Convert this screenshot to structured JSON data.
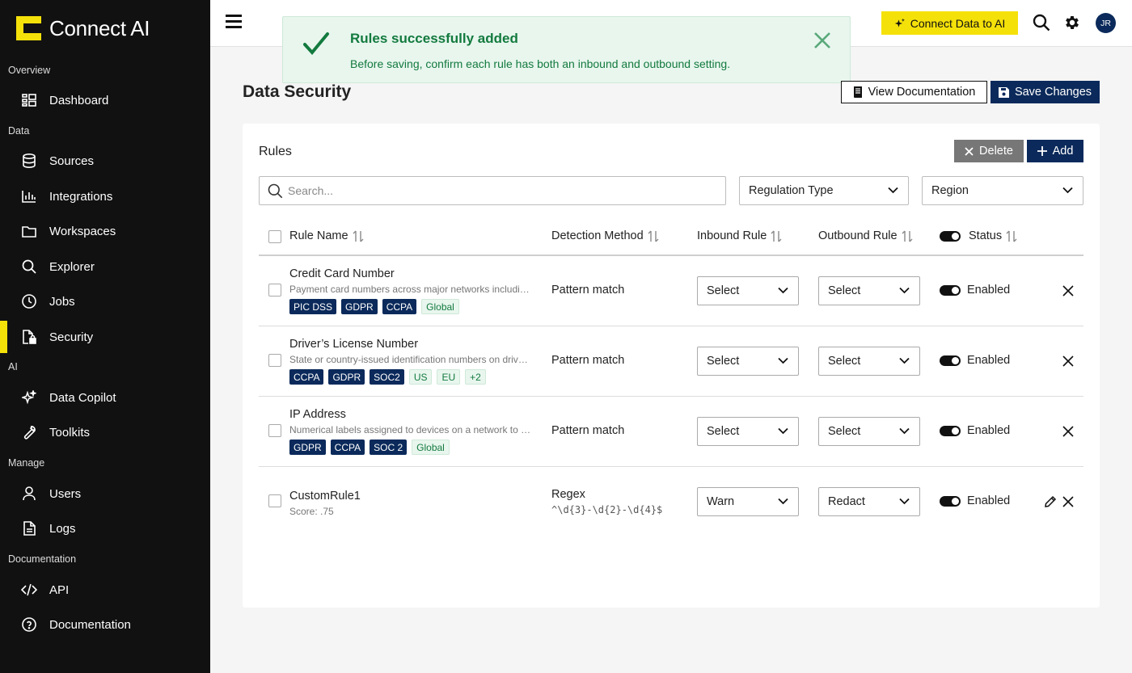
{
  "brand": {
    "name": "Connect AI",
    "accent": "#f5e10a"
  },
  "sidebar": {
    "sections": [
      {
        "label": "Overview"
      },
      {
        "label": "Data"
      },
      {
        "label": "AI"
      },
      {
        "label": "Manage"
      },
      {
        "label": "Documentation"
      }
    ],
    "items": [
      {
        "label": "Dashboard",
        "icon": "dashboard-icon"
      },
      {
        "label": "Sources",
        "icon": "database-icon"
      },
      {
        "label": "Integrations",
        "icon": "bar-chart-icon"
      },
      {
        "label": "Workspaces",
        "icon": "folder-icon"
      },
      {
        "label": "Explorer",
        "icon": "search-icon"
      },
      {
        "label": "Jobs",
        "icon": "clock-icon"
      },
      {
        "label": "Security",
        "icon": "document-lock-icon",
        "active": true
      },
      {
        "label": "Data Copilot",
        "icon": "sparkle-icon"
      },
      {
        "label": "Toolkits",
        "icon": "wrench-icon"
      },
      {
        "label": "Users",
        "icon": "user-icon"
      },
      {
        "label": "Logs",
        "icon": "file-text-icon"
      },
      {
        "label": "API",
        "icon": "code-icon"
      },
      {
        "label": "Documentation",
        "icon": "help-circle-icon"
      }
    ]
  },
  "topbar": {
    "connect_label": "Connect Data to AI",
    "avatar_initials": "JR"
  },
  "toast": {
    "title": "Rules successfully added",
    "message": "Before saving, confirm each rule has both an inbound and outbound setting.",
    "color": "#137a3e"
  },
  "page": {
    "title": "Data Security",
    "view_docs_label": "View Documentation",
    "save_label": "Save Changes"
  },
  "rules": {
    "title": "Rules",
    "delete_label": "Delete",
    "add_label": "Add",
    "search_placeholder": "Search...",
    "filters": {
      "regulation": "Regulation Type",
      "region": "Region"
    },
    "columns": {
      "name": "Rule Name",
      "method": "Detection Method",
      "inbound": "Inbound Rule",
      "outbound": "Outbound Rule",
      "status": "Status"
    },
    "rows": [
      {
        "name": "Credit Card Number",
        "description": "Payment card numbers across major networks including Visa, Mastercard and Amex",
        "tags": [
          {
            "text": "PIC DSS",
            "style": "dark"
          },
          {
            "text": "GDPR",
            "style": "dark"
          },
          {
            "text": "CCPA",
            "style": "dark"
          },
          {
            "text": "Global",
            "style": "light"
          }
        ],
        "method": "Pattern match",
        "inbound": "Select",
        "outbound": "Select",
        "status": "Enabled"
      },
      {
        "name": "Driver’s License Number",
        "description": "State or country-issued identification numbers on driver licenses",
        "tags": [
          {
            "text": "CCPA",
            "style": "dark"
          },
          {
            "text": "GDPR",
            "style": "dark"
          },
          {
            "text": "SOC2",
            "style": "dark"
          },
          {
            "text": "US",
            "style": "light"
          },
          {
            "text": "EU",
            "style": "light"
          },
          {
            "text": "+2",
            "style": "light"
          }
        ],
        "method": "Pattern match",
        "inbound": "Select",
        "outbound": "Select",
        "status": "Enabled"
      },
      {
        "name": "IP Address",
        "description": "Numerical labels assigned to devices on a network to identify them",
        "tags": [
          {
            "text": "GDPR",
            "style": "dark"
          },
          {
            "text": "CCPA",
            "style": "dark"
          },
          {
            "text": "SOC 2",
            "style": "dark"
          },
          {
            "text": "Global",
            "style": "light"
          }
        ],
        "method": "Pattern match",
        "inbound": "Select",
        "outbound": "Select",
        "status": "Enabled"
      },
      {
        "name": "CustomRule1",
        "score": "Score: .75",
        "method": "Regex",
        "regex": "^\\d{3}-\\d{2}-\\d{4}$",
        "inbound": "Warn",
        "outbound": "Redact",
        "status": "Enabled"
      }
    ]
  }
}
